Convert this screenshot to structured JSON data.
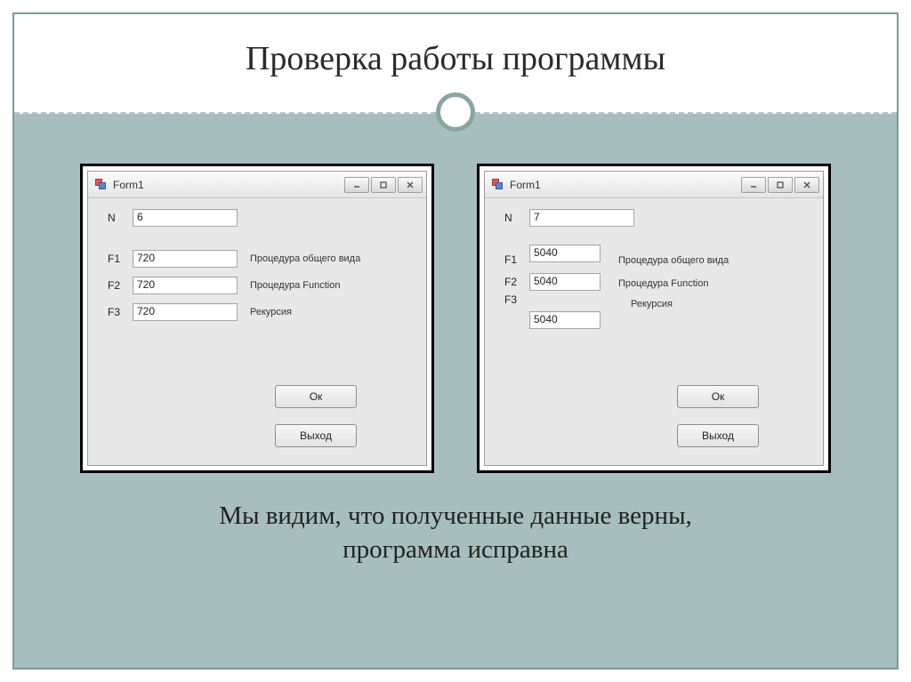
{
  "slide": {
    "title": "Проверка работы программы",
    "caption_line1": "Мы видим, что полученные данные верны,",
    "caption_line2": "программа исправна"
  },
  "formA": {
    "title": "Form1",
    "n_label": "N",
    "n_value": "6",
    "rows": [
      {
        "label": "F1",
        "value": "720",
        "desc": "Процедура общего вида"
      },
      {
        "label": "F2",
        "value": "720",
        "desc": "Процедура Function"
      },
      {
        "label": "F3",
        "value": "720",
        "desc": "Рекурсия"
      }
    ],
    "ok_label": "Ок",
    "exit_label": "Выход"
  },
  "formB": {
    "title": "Form1",
    "n_label": "N",
    "n_value": "7",
    "rows": [
      {
        "label": "F1",
        "value": "5040",
        "desc": "Процедура общего вида"
      },
      {
        "label": "F2",
        "value": "5040",
        "desc": "Процедура Function"
      },
      {
        "label": "F3",
        "value": "5040",
        "desc": "Рекурсия"
      }
    ],
    "ok_label": "Ок",
    "exit_label": "Выход"
  }
}
